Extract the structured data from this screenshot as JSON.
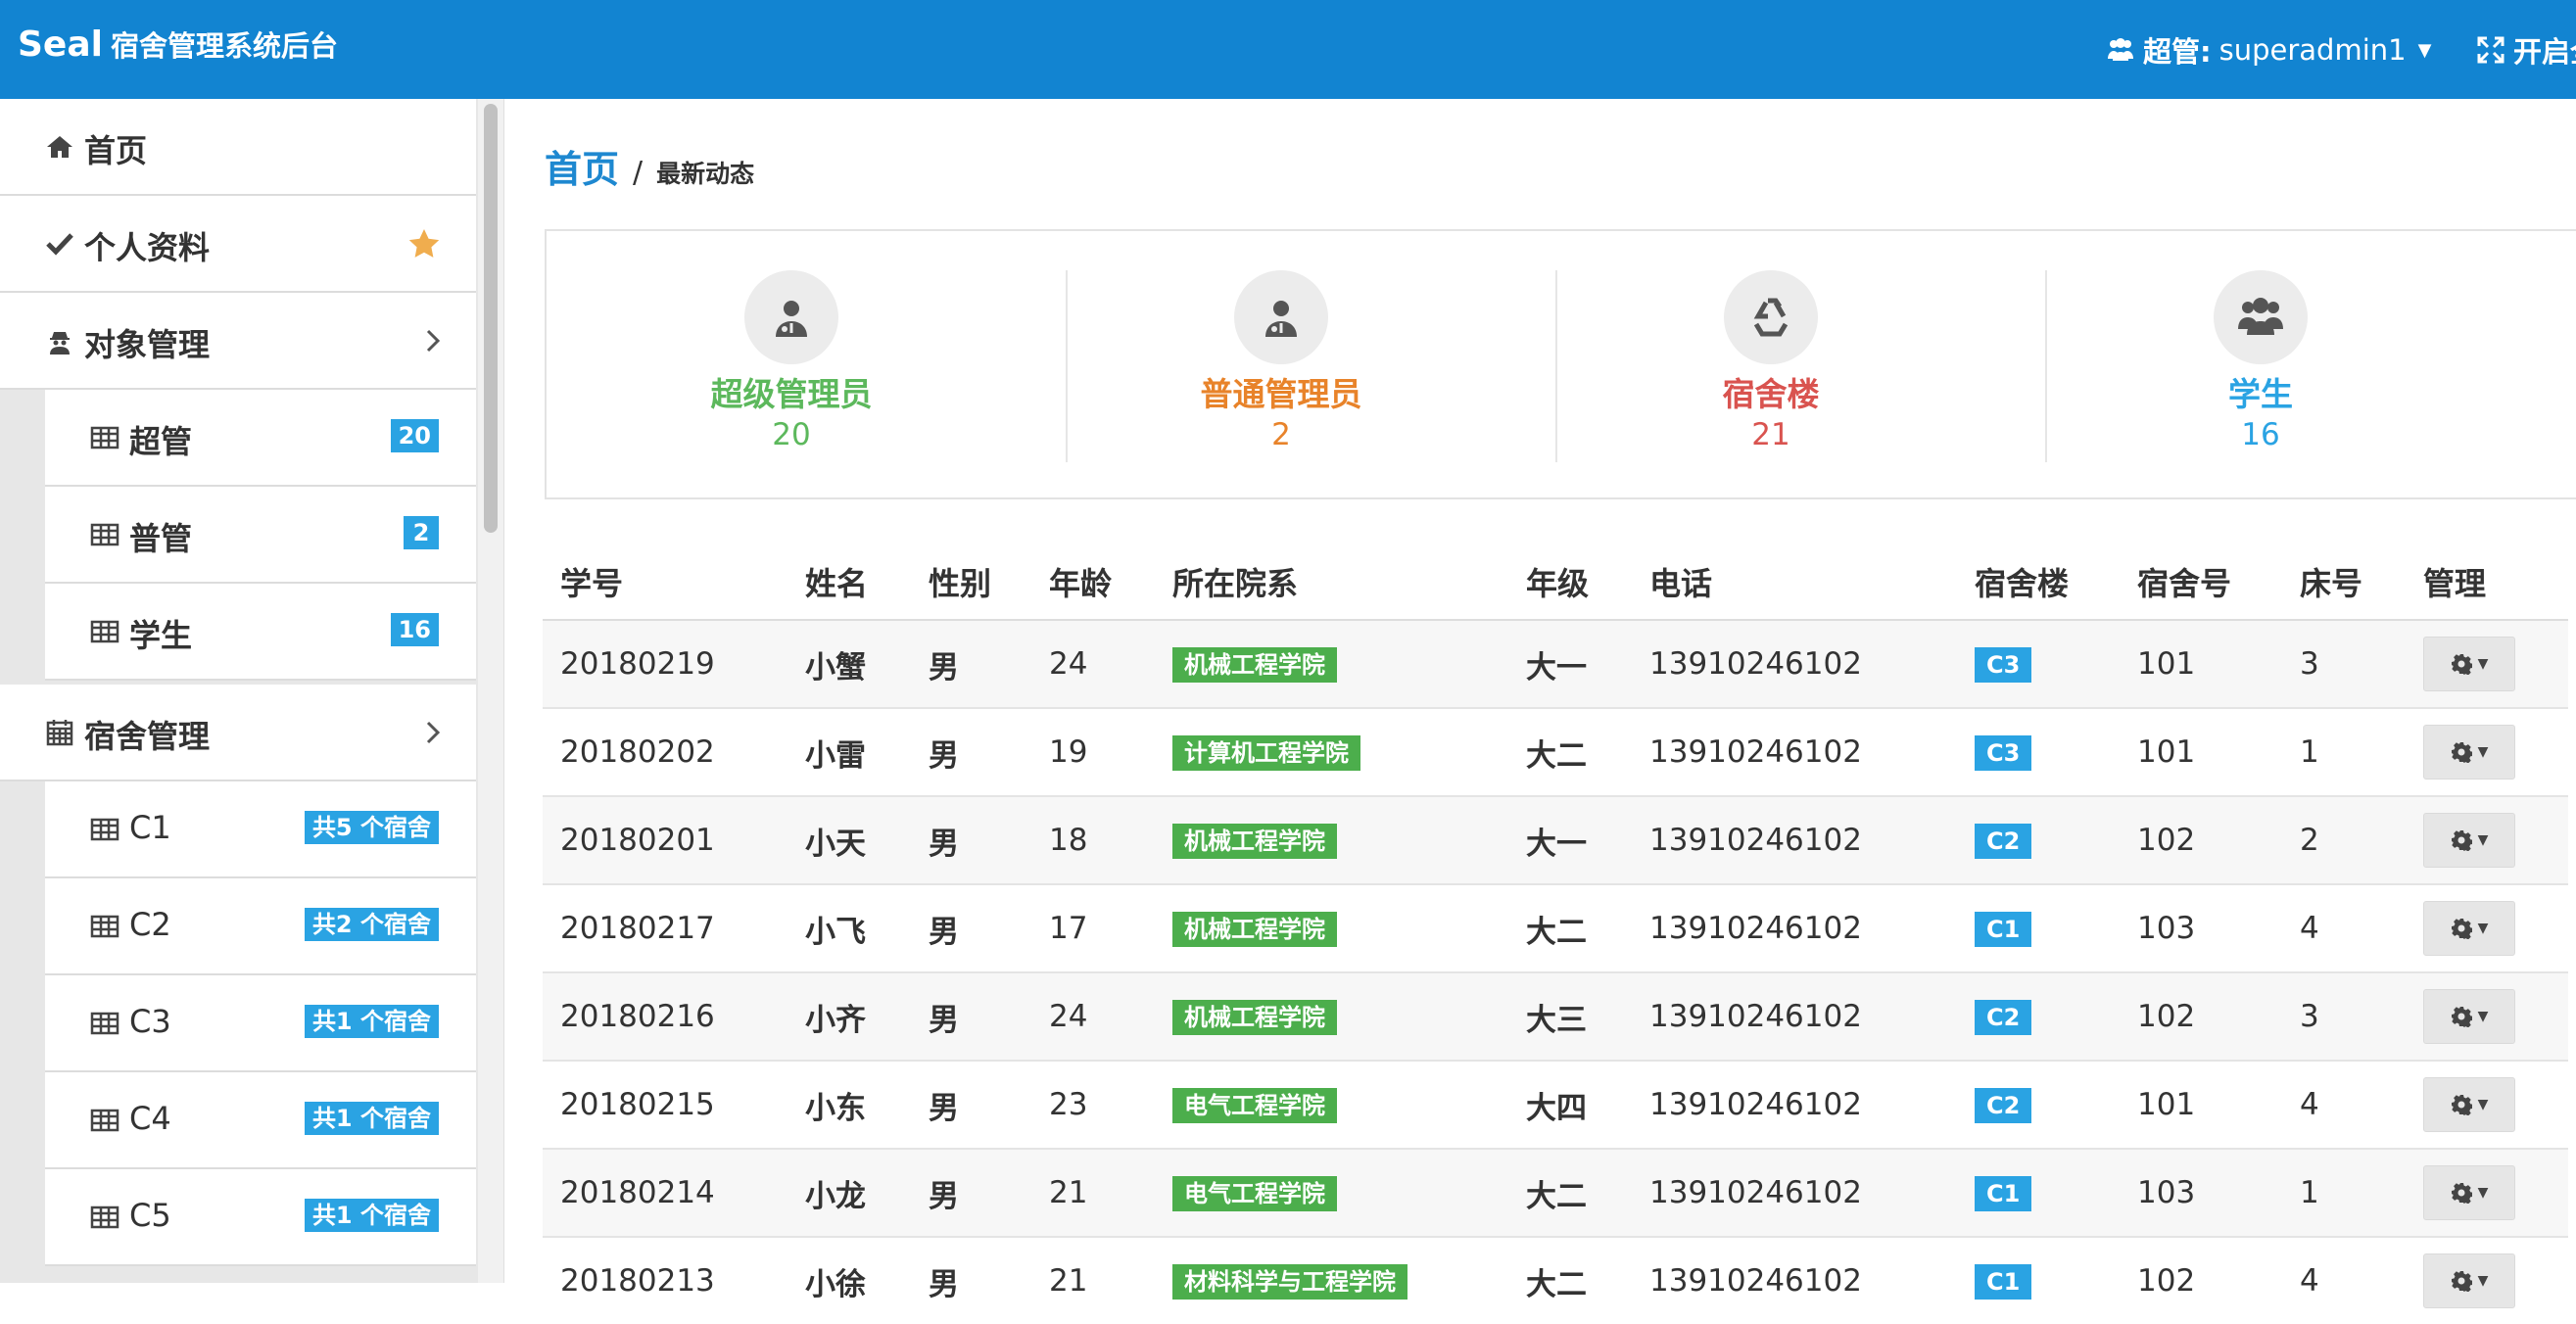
{
  "header": {
    "brand": "Seal",
    "subtitle": "宿舍管理系统后台",
    "user_role": "超管:",
    "username": "superadmin1",
    "fullscreen_label": "开启全"
  },
  "sidebar": {
    "items": [
      {
        "label": "首页",
        "icon": "home-icon"
      },
      {
        "label": "个人资料",
        "icon": "check-icon",
        "trailing": "star-icon"
      },
      {
        "label": "对象管理",
        "icon": "user-secret-icon",
        "trailing": "chevron-right-icon"
      },
      {
        "label": "超管",
        "icon": "table-icon",
        "badge": "20"
      },
      {
        "label": "普管",
        "icon": "table-icon",
        "badge": "2"
      },
      {
        "label": "学生",
        "icon": "table-icon",
        "badge": "16"
      },
      {
        "label": "宿舍管理",
        "icon": "calendar-icon",
        "trailing": "chevron-right-icon"
      },
      {
        "label": "C1",
        "icon": "table-icon",
        "badge": "共5 个宿舍"
      },
      {
        "label": "C2",
        "icon": "table-icon",
        "badge": "共2 个宿舍"
      },
      {
        "label": "C3",
        "icon": "table-icon",
        "badge": "共1 个宿舍"
      },
      {
        "label": "C4",
        "icon": "table-icon",
        "badge": "共1 个宿舍"
      },
      {
        "label": "C5",
        "icon": "table-icon",
        "badge": "共1 个宿舍"
      }
    ]
  },
  "breadcrumb": {
    "home": "首页",
    "separator": "/",
    "current": "最新动态"
  },
  "stats": [
    {
      "label": "超级管理员",
      "count": "20",
      "color": "#5cb85c",
      "icon": "user-md-icon"
    },
    {
      "label": "普通管理员",
      "count": "2",
      "color": "#e8832a",
      "icon": "user-md-icon"
    },
    {
      "label": "宿舍楼",
      "count": "21",
      "color": "#d9534f",
      "icon": "recycle-icon"
    },
    {
      "label": "学生",
      "count": "16",
      "color": "#2aa3e3",
      "icon": "users-icon"
    }
  ],
  "table": {
    "columns": [
      "学号",
      "姓名",
      "性别",
      "年龄",
      "所在院系",
      "年级",
      "电话",
      "宿舍楼",
      "宿舍号",
      "床号",
      "管理"
    ],
    "rows": [
      {
        "id": "20180219",
        "name": "小蟹",
        "gender": "男",
        "age": "24",
        "dept": "机械工程学院",
        "grade": "大一",
        "phone": "13910246102",
        "building": "C3",
        "room": "101",
        "bed": "3"
      },
      {
        "id": "20180202",
        "name": "小雷",
        "gender": "男",
        "age": "19",
        "dept": "计算机工程学院",
        "grade": "大二",
        "phone": "13910246102",
        "building": "C3",
        "room": "101",
        "bed": "1"
      },
      {
        "id": "20180201",
        "name": "小天",
        "gender": "男",
        "age": "18",
        "dept": "机械工程学院",
        "grade": "大一",
        "phone": "13910246102",
        "building": "C2",
        "room": "102",
        "bed": "2"
      },
      {
        "id": "20180217",
        "name": "小飞",
        "gender": "男",
        "age": "17",
        "dept": "机械工程学院",
        "grade": "大二",
        "phone": "13910246102",
        "building": "C1",
        "room": "103",
        "bed": "4"
      },
      {
        "id": "20180216",
        "name": "小齐",
        "gender": "男",
        "age": "24",
        "dept": "机械工程学院",
        "grade": "大三",
        "phone": "13910246102",
        "building": "C2",
        "room": "102",
        "bed": "3"
      },
      {
        "id": "20180215",
        "name": "小东",
        "gender": "男",
        "age": "23",
        "dept": "电气工程学院",
        "grade": "大四",
        "phone": "13910246102",
        "building": "C2",
        "room": "101",
        "bed": "4"
      },
      {
        "id": "20180214",
        "name": "小龙",
        "gender": "男",
        "age": "21",
        "dept": "电气工程学院",
        "grade": "大二",
        "phone": "13910246102",
        "building": "C1",
        "room": "103",
        "bed": "1"
      },
      {
        "id": "20180213",
        "name": "小徐",
        "gender": "男",
        "age": "21",
        "dept": "材料科学与工程学院",
        "grade": "大二",
        "phone": "13910246102",
        "building": "C1",
        "room": "102",
        "bed": "4"
      }
    ]
  },
  "colors": {
    "topbar": "#1284d1",
    "accent_blue": "#2aa3e3",
    "dept_green": "#4cae4c",
    "star": "#f0ad4e"
  }
}
